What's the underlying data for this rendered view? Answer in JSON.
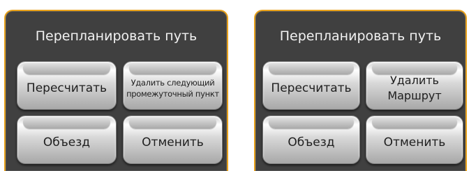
{
  "dialogs": [
    {
      "title": "Перепланировать путь",
      "buttons": {
        "recalc": "Пересчитать",
        "delete_waypoint": [
          "Удалить следующий",
          "промежуточный пункт"
        ],
        "detour": "Объезд",
        "cancel": "Отменить"
      }
    },
    {
      "title": "Перепланировать путь",
      "buttons": {
        "recalc": "Пересчитать",
        "delete_route": [
          "Удалить",
          "Маршрут"
        ],
        "detour": "Объезд",
        "cancel": "Отменить"
      }
    }
  ],
  "colors": {
    "panel": "#404040",
    "border": "#e8a11a",
    "title_text": "#f2f2f2",
    "button_text": "#1e1e1e"
  }
}
